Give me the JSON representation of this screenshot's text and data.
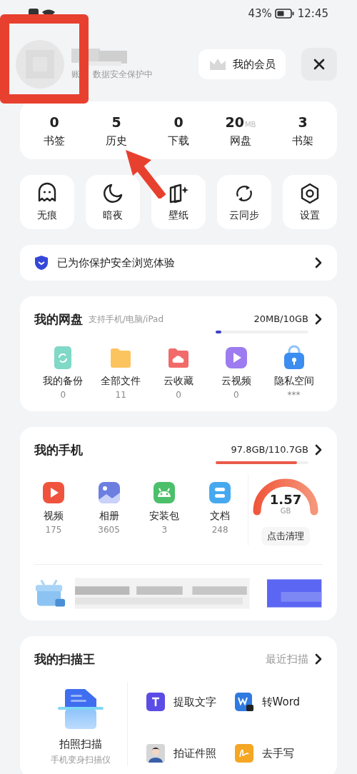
{
  "status_bar": {
    "battery": "43%",
    "time": "12:45"
  },
  "account": {
    "note": [
      "账",
      "数据安全保护中"
    ]
  },
  "member_button": {
    "label": "我的会员"
  },
  "stats": [
    {
      "value": "0",
      "label": "书签"
    },
    {
      "value": "5",
      "label": "历史"
    },
    {
      "value": "0",
      "label": "下载"
    },
    {
      "value": "20",
      "unit": "MB",
      "label": "网盘"
    },
    {
      "value": "3",
      "label": "书架"
    }
  ],
  "tools": [
    {
      "kind": "ghost",
      "label": "无痕"
    },
    {
      "kind": "moon",
      "label": "暗夜"
    },
    {
      "kind": "wallpaper",
      "label": "壁纸"
    },
    {
      "kind": "sync",
      "label": "云同步"
    },
    {
      "kind": "settings",
      "label": "设置"
    }
  ],
  "safety_bar": {
    "text": "已为你保护安全浏览体验"
  },
  "netdisk": {
    "title": "我的网盘",
    "subtitle": "支持手机/电脑/iPad",
    "usage": "20MB/10GB",
    "level": 0.03,
    "items": [
      {
        "kind": "backup",
        "label": "我的备份",
        "count": "0"
      },
      {
        "kind": "folder",
        "label": "全部文件",
        "count": "11"
      },
      {
        "kind": "cloud",
        "label": "云收藏",
        "count": "0"
      },
      {
        "kind": "video",
        "label": "云视频",
        "count": "0"
      },
      {
        "kind": "lock",
        "label": "隐私空间",
        "count": "***"
      }
    ]
  },
  "phone": {
    "title": "我的手机",
    "usage": "97.8GB/110.7GB",
    "level": 0.88,
    "items": [
      {
        "kind": "video",
        "label": "视频",
        "count": "175"
      },
      {
        "kind": "album",
        "label": "相册",
        "count": "3605"
      },
      {
        "kind": "apk",
        "label": "安装包",
        "count": "3"
      },
      {
        "kind": "doc",
        "label": "文档",
        "count": "248"
      }
    ],
    "gauge": {
      "value": "1.57",
      "unit": "GB",
      "button": "点击清理"
    }
  },
  "scanner": {
    "title": "我的扫描王",
    "link": "最近扫描",
    "main": {
      "label": "拍照扫描",
      "caption": "手机变身扫描仪"
    },
    "tools": [
      {
        "kind": "text",
        "label": "提取文字"
      },
      {
        "kind": "word",
        "label": "转Word"
      },
      {
        "kind": "idphoto",
        "label": "拍证件照"
      },
      {
        "kind": "handwriting",
        "label": "去手写"
      }
    ]
  }
}
